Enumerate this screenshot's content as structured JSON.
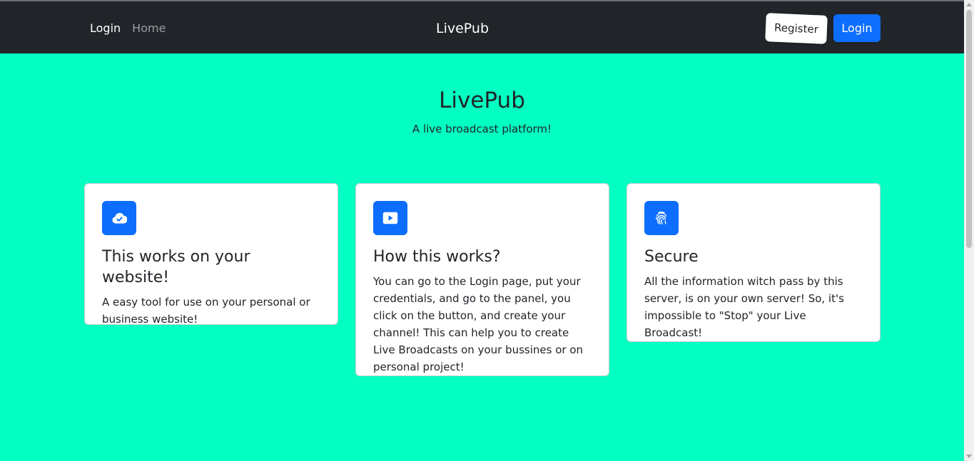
{
  "navbar": {
    "links": [
      {
        "label": "Login",
        "active": true
      },
      {
        "label": "Home",
        "active": false
      }
    ],
    "brand": "LivePub",
    "register_label": "Register",
    "login_label": "Login"
  },
  "hero": {
    "title": "LivePub",
    "subtitle": "A live broadcast platform!"
  },
  "cards": [
    {
      "icon": "cloud-check-icon",
      "title": "This works on your website!",
      "text": "A easy tool for use on your personal or business website!"
    },
    {
      "icon": "play-button-icon",
      "title": "How this works?",
      "text": "You can go to the Login page, put your credentials, and go to the panel, you click on the button, and create your channel! This can help you to create Live Broadcasts on your bussines or on personal project!"
    },
    {
      "icon": "fingerprint-icon",
      "title": "Secure",
      "text": "All the information witch pass by this server, is on your own server! So, it's impossible to \"Stop\" your Live Broadcast!"
    }
  ],
  "colors": {
    "background": "#04ffc2",
    "navbar": "#212529",
    "primary": "#0d6efd"
  }
}
